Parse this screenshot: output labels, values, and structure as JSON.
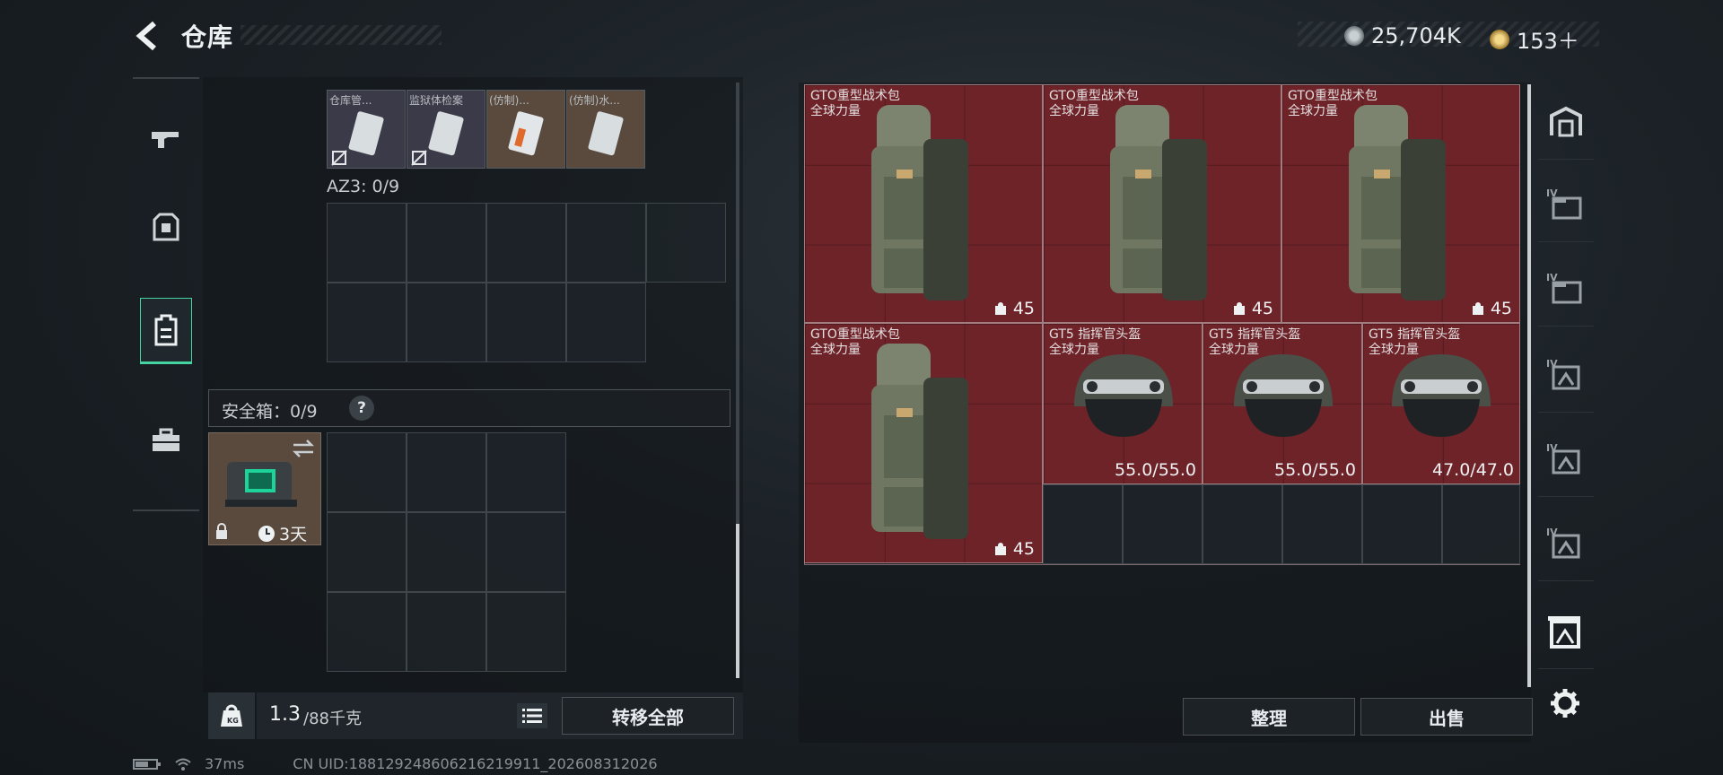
{
  "header": {
    "title": "仓库",
    "currency1": "25,704K",
    "currency2": "153＋"
  },
  "left_nav": {
    "items": [
      "weapon-icon",
      "armor-icon",
      "backpack-icon",
      "toolbox-icon"
    ],
    "active": "backpack-icon"
  },
  "top_items": [
    {
      "label": "仓库管..."
    },
    {
      "label": "监狱体检案"
    },
    {
      "label": "(仿制)..."
    },
    {
      "label": "(仿制)水..."
    }
  ],
  "az3": {
    "label": "AZ3: 0/9"
  },
  "safe_box": {
    "label": "安全箱：0/9",
    "help": "?",
    "timer": "3天"
  },
  "bottom_left": {
    "weight_current": "1.3",
    "weight_max": "/88千克",
    "transfer_all": "转移全部"
  },
  "stash": {
    "items": [
      {
        "name1": "GTO重型战术包",
        "name2": "全球力量",
        "type": "backpack",
        "badge": "45"
      },
      {
        "name1": "GTO重型战术包",
        "name2": "全球力量",
        "type": "backpack",
        "badge": "45"
      },
      {
        "name1": "GTO重型战术包",
        "name2": "全球力量",
        "type": "backpack",
        "badge": "45"
      },
      {
        "name1": "GTO重型战术包",
        "name2": "全球力量",
        "type": "backpack",
        "badge": "45"
      },
      {
        "name1": "GT5 指挥官头盔",
        "name2": "全球力量",
        "type": "helmet",
        "durability": "55.0/55.0"
      },
      {
        "name1": "GT5 指挥官头盔",
        "name2": "全球力量",
        "type": "helmet",
        "durability": "55.0/55.0"
      },
      {
        "name1": "GT5 指挥官头盔",
        "name2": "全球力量",
        "type": "helmet",
        "durability": "47.0/47.0"
      }
    ],
    "sort_label": "整理",
    "sell_label": "出售"
  },
  "right_nav": {
    "items": [
      "armory-icon",
      "tier4-folder-icon",
      "tier4-folder-icon",
      "tier4-stash-icon",
      "tier4-stash-icon",
      "tier4-stash-icon",
      "stash-selected-icon",
      "settings-icon"
    ]
  },
  "status_bar": {
    "ping": "37ms",
    "uid": "CN UID:188129248606216219911_202608312026"
  },
  "colors": {
    "accent": "#44d3a1",
    "item_bg": "#6e2329"
  }
}
